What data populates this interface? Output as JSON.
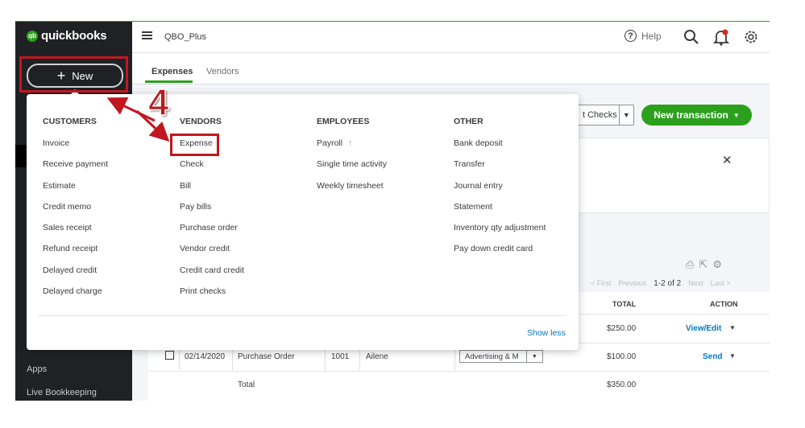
{
  "app": {
    "logo_small": "intuit",
    "logo": "quickbooks",
    "company": "QBO_Plus",
    "help_label": "Help",
    "new_button": "New"
  },
  "sidebar": {
    "links": [
      "Apps",
      "Live Bookkeeping"
    ]
  },
  "tabs": [
    "Expenses",
    "Vendors"
  ],
  "toolbar": {
    "checks_label": "t Checks",
    "new_transaction_label": "New transaction"
  },
  "table": {
    "pager": {
      "first": "< First",
      "previous": "Previous",
      "current": "1-2 of 2",
      "next": "Next",
      "last": "Last >"
    },
    "headers": {
      "total": "TOTAL",
      "action": "ACTION"
    },
    "rows": [
      {
        "date": "",
        "type": "",
        "no": "",
        "payee": "",
        "category": "",
        "total": "$250.00",
        "action": "View/Edit"
      },
      {
        "date": "02/14/2020",
        "type": "Purchase Order",
        "no": "1001",
        "payee": "Ailene",
        "category": "Advertising & M",
        "total": "$100.00",
        "action": "Send"
      }
    ],
    "footer": {
      "label": "Total",
      "total": "$350.00"
    }
  },
  "menu": {
    "columns": [
      {
        "heading": "CUSTOMERS",
        "items": [
          "Invoice",
          "Receive payment",
          "Estimate",
          "Credit memo",
          "Sales receipt",
          "Refund receipt",
          "Delayed credit",
          "Delayed charge"
        ]
      },
      {
        "heading": "VENDORS",
        "items": [
          "Expense",
          "Check",
          "Bill",
          "Pay bills",
          "Purchase order",
          "Vendor credit",
          "Credit card credit",
          "Print checks"
        ]
      },
      {
        "heading": "EMPLOYEES",
        "items": [
          "Payroll",
          "Single time activity",
          "Weekly timesheet"
        ]
      },
      {
        "heading": "OTHER",
        "items": [
          "Bank deposit",
          "Transfer",
          "Journal entry",
          "Statement",
          "Inventory qty adjustment",
          "Pay down credit card"
        ]
      }
    ],
    "show_less": "Show less"
  },
  "annotation": {
    "step_number": "4",
    "color": "#c0181e"
  },
  "colors": {
    "brand_green": "#2ca01c",
    "sidebar": "#1f2125",
    "link_blue": "#0077c5"
  }
}
